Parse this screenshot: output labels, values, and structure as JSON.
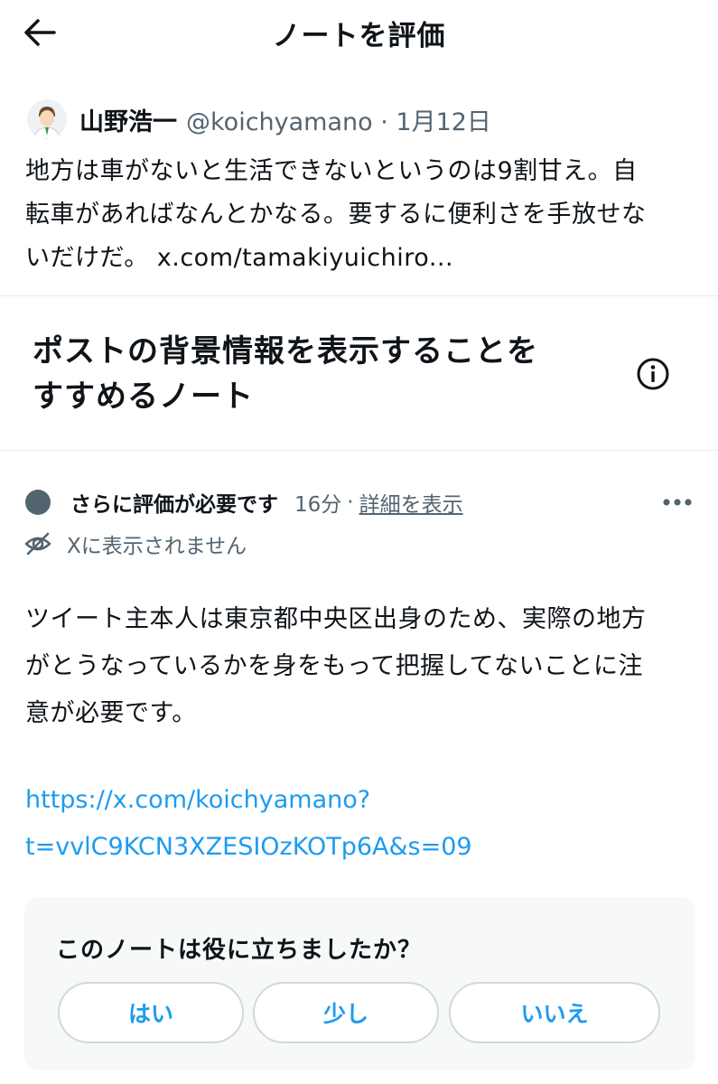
{
  "header": {
    "title": "ノートを評価",
    "back_icon": "arrow-left-icon"
  },
  "post": {
    "author_name": "山野浩一",
    "author_handle": "@koichyamano · 1月12日",
    "text_lines": [
      "地方は車がないと生活できないというのは9割甘え。自",
      "転車があればなんとかなる。要するに便利さを手放せな",
      "いだけだ。 x.com/tamakiyuichiro..."
    ]
  },
  "section": {
    "title_lines": [
      "ポストの背景情報を表示することを",
      "すすめるノート"
    ],
    "info_icon": "info-icon"
  },
  "note": {
    "status": "さらに評価が必要です",
    "time": "16分",
    "separator": "·",
    "details_link": "詳細を表示",
    "visibility": "Xに表示されません",
    "body_lines": [
      "ツイート主本人は東京都中央区出身のため、実際の地方",
      "がとうなっているかを身をもって把握してないことに注",
      "意が必要です。"
    ],
    "link_lines": [
      "https://x.com/koichyamano?",
      "t=vvlC9KCN3XZESIOzKOTp6A&s=09"
    ]
  },
  "rating": {
    "question": "このノートは役に立ちましたか？",
    "options": [
      "はい",
      "少し",
      "いいえ"
    ]
  },
  "colors": {
    "accent": "#1d9bf0",
    "secondary_text": "#536471",
    "card_background": "#f7f9f9",
    "divider": "#e6ebee"
  }
}
